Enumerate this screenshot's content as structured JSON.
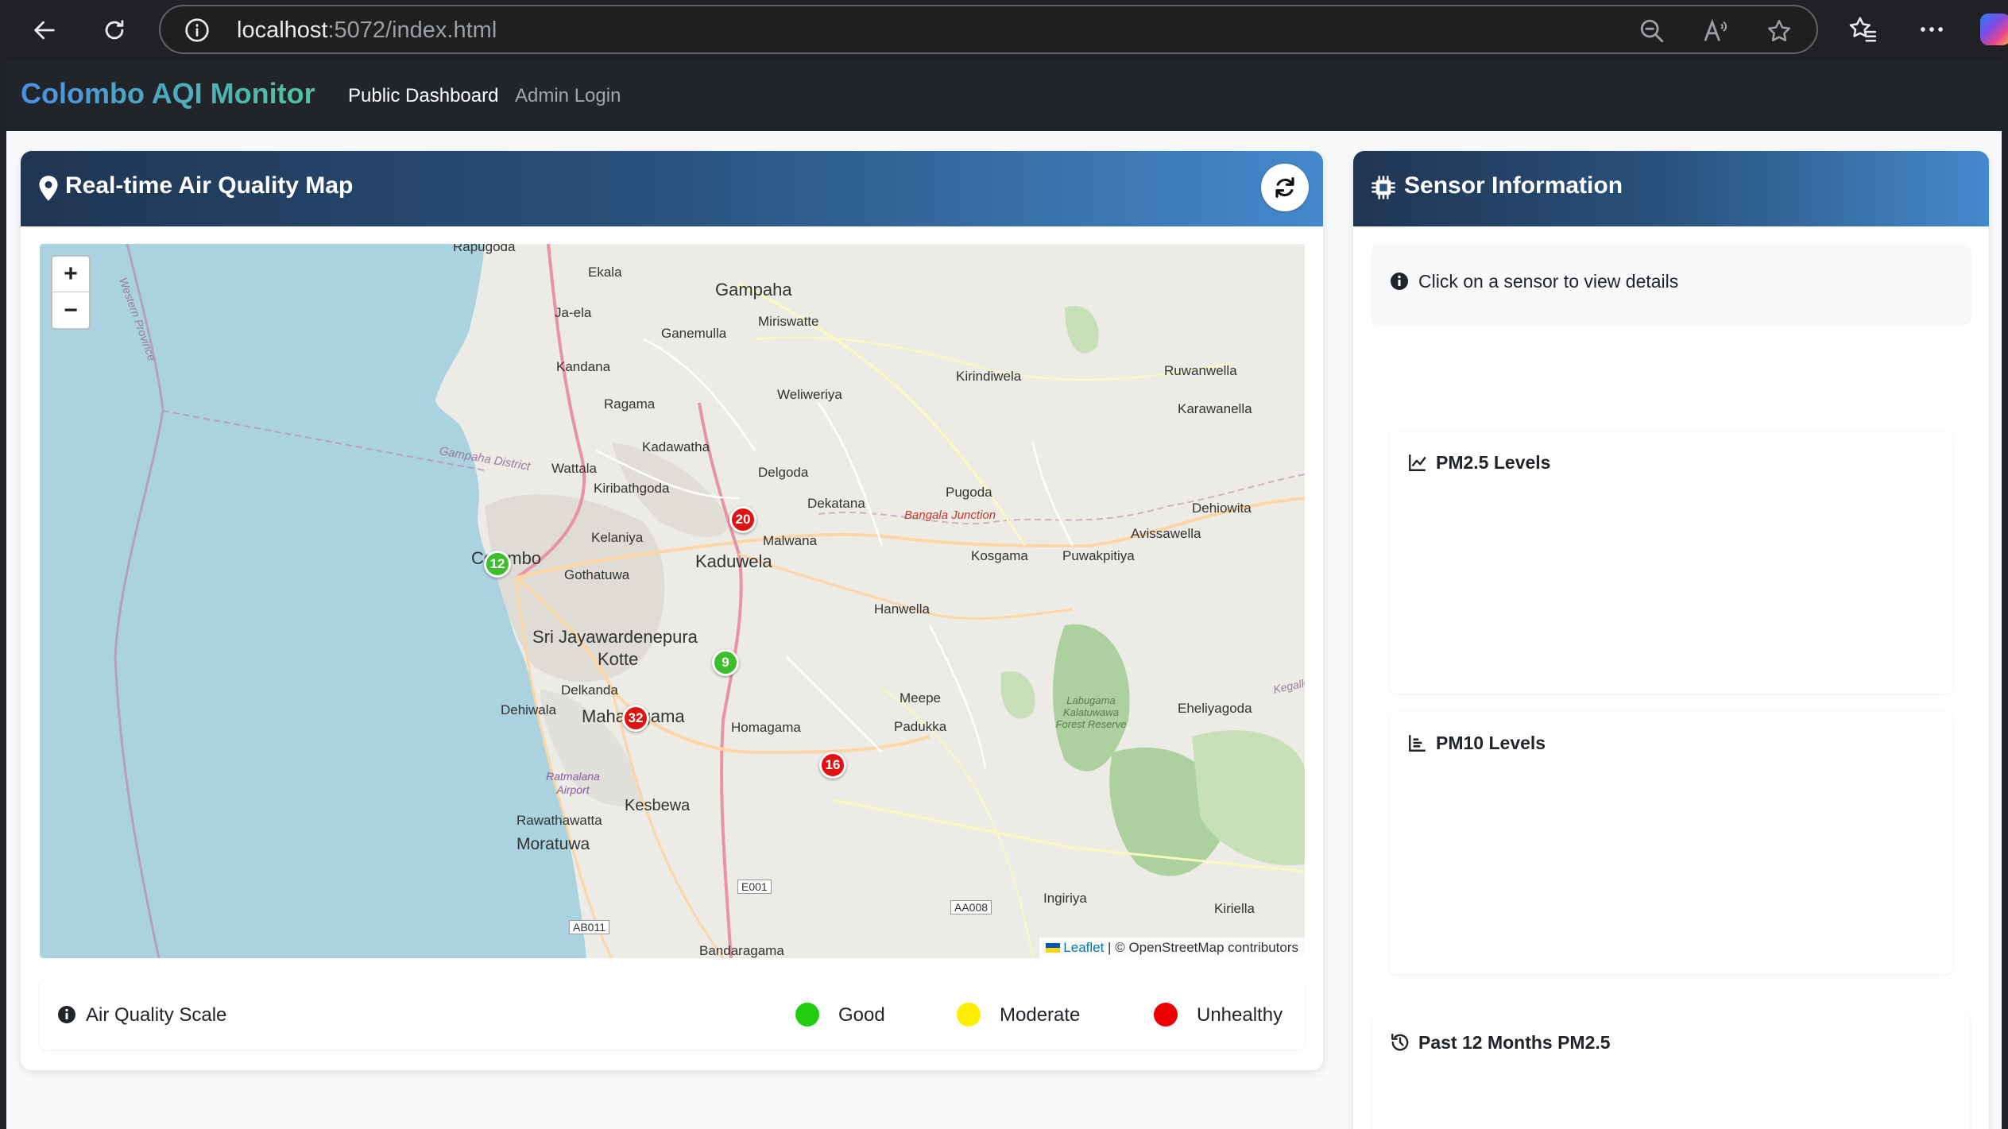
{
  "browser": {
    "url_host": "localhost",
    "url_rest": ":5072/index.html"
  },
  "navbar": {
    "brand": "Colombo AQI Monitor",
    "links": [
      {
        "label": "Public Dashboard",
        "active": true
      },
      {
        "label": "Admin Login",
        "active": false
      }
    ]
  },
  "map_card": {
    "title": "Real-time Air Quality Map",
    "zoom_in": "+",
    "zoom_out": "−",
    "attribution": {
      "leaflet": "Leaflet",
      "rest": " | © OpenStreetMap contributors"
    },
    "map_labels": [
      "Rapugoda",
      "Ekala",
      "Gampaha",
      "Ja-ela",
      "Miriswatte",
      "Ganemulla",
      "Kandana",
      "Kirindiwela",
      "Ruwanwella",
      "Karawanella",
      "Ragama",
      "Weliweriya",
      "Kadawatha",
      "Gampaha District",
      "Wattala",
      "Delgoda",
      "Kiribathgoda",
      "Pugoda",
      "Dekatana",
      "Bangala Junction",
      "Dehiowita",
      "Kelaniya",
      "Malwana",
      "Avissawella",
      "Colombo",
      "Kaduwela",
      "Kosgama",
      "Puwakpitiya",
      "Gothatuwa",
      "Hanwella",
      "Sri Jayawardenepura",
      "Kotte",
      "Delkanda",
      "Meepe",
      "Kegalle",
      "Dehiwala",
      "Maharagama",
      "Homagama",
      "Padukka",
      "Labugama Kalatuwawa Forest Reserve",
      "Eheliyagoda",
      "Ratmalana Airport",
      "Kesbewa",
      "Rawathawatta",
      "Moratuwa",
      "E001",
      "AA008",
      "Ingiriya",
      "Kiriella",
      "AB011",
      "Bandaragama",
      "Western Province"
    ],
    "sensors": [
      {
        "value": "12",
        "status": "good"
      },
      {
        "value": "20",
        "status": "unhealthy"
      },
      {
        "value": "9",
        "status": "good"
      },
      {
        "value": "32",
        "status": "unhealthy"
      },
      {
        "value": "16",
        "status": "unhealthy"
      }
    ]
  },
  "air_quality_scale": {
    "title": "Air Quality Scale",
    "levels": [
      {
        "label": "Good",
        "color": "#22cc11"
      },
      {
        "label": "Moderate",
        "color": "#ffee00"
      },
      {
        "label": "Unhealthy",
        "color": "#ee0000"
      }
    ]
  },
  "sensor_card": {
    "title": "Sensor Information",
    "info": "Click on a sensor to view details",
    "charts": [
      {
        "title": "PM2.5 Levels",
        "icon": "line-chart-icon"
      },
      {
        "title": "PM10 Levels",
        "icon": "bar-chart-icon"
      },
      {
        "title": "Past 12 Months PM2.5",
        "icon": "history-icon"
      }
    ]
  },
  "colors": {
    "header_gradient_start": "#1f3552",
    "header_gradient_end": "#4489cc",
    "navbar_bg": "#212529",
    "good": "#3cbe2d",
    "unhealthy": "#e11212"
  }
}
